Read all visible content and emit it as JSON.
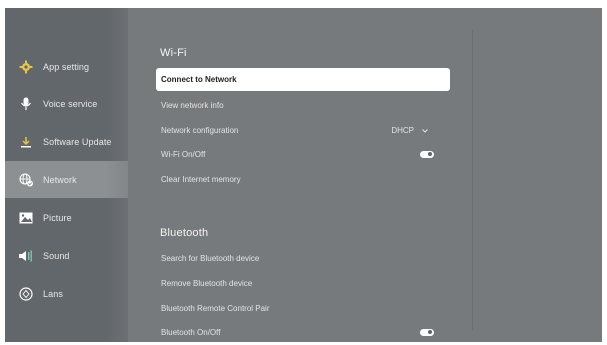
{
  "sidebar": {
    "items": [
      {
        "label": "App setting",
        "icon": "gear-icon",
        "active": false
      },
      {
        "label": "Voice service",
        "icon": "microphone-icon",
        "active": false
      },
      {
        "label": "Software Update",
        "icon": "download-icon",
        "active": false
      },
      {
        "label": "Network",
        "icon": "network-globe-icon",
        "active": true
      },
      {
        "label": "Picture",
        "icon": "picture-icon",
        "active": false
      },
      {
        "label": "Sound",
        "icon": "speaker-icon",
        "active": false
      },
      {
        "label": "Lans",
        "icon": "lens-icon",
        "active": false
      }
    ]
  },
  "wifi": {
    "title": "Wi-Fi",
    "items": [
      {
        "label": "Connect to Network",
        "selected": true
      },
      {
        "label": "View network info"
      },
      {
        "label": "Network configuration",
        "value": "DHCP"
      },
      {
        "label": "Wi-Fi On/Off",
        "toggle": "on"
      },
      {
        "label": "Clear Internet memory"
      }
    ]
  },
  "bluetooth": {
    "title": "Bluetooth",
    "items": [
      {
        "label": "Search for Bluetooth device"
      },
      {
        "label": "Remove Bluetooth device"
      },
      {
        "label": "Bluetooth Remote Control Pair"
      },
      {
        "label": "Bluetooth On/Off",
        "toggle": "on"
      }
    ]
  },
  "colors": {
    "sidebar_bg": "#62676b",
    "content_bg": "#777a7c",
    "selected_bg": "#ffffff",
    "active_item_bg": "#8d9092"
  }
}
